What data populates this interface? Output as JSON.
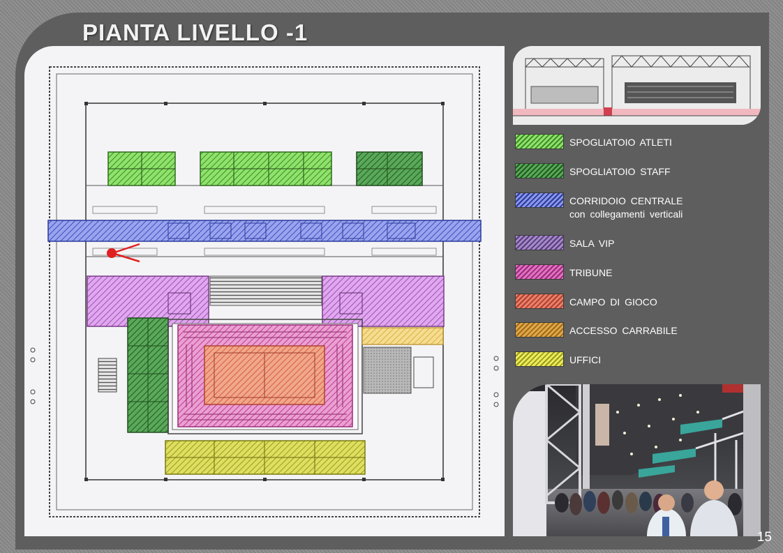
{
  "page": {
    "title": "PIANTA LIVELLO -1",
    "page_number": "15"
  },
  "legend": [
    {
      "label": "SPOGLIATOIO ATLETI",
      "sub": "",
      "color": "#7ed957"
    },
    {
      "label": "SPOGLIATOIO STAFF",
      "sub": "",
      "color": "#3c8a3c"
    },
    {
      "label": "CORRIDOIO CENTRALE",
      "sub": "con collegamenti verticali",
      "color": "#3b4fbf"
    },
    {
      "label": "SALA VIP",
      "sub": "",
      "color": "#7a5aa0"
    },
    {
      "label": "TRIBUNE",
      "sub": "",
      "color": "#c0389a"
    },
    {
      "label": "CAMPO DI GIOCO",
      "sub": "",
      "color": "#d65a4e"
    },
    {
      "label": "ACCESSO CARRABILE",
      "sub": "",
      "color": "#d08a2e"
    },
    {
      "label": "UFFICI",
      "sub": "",
      "color": "#d8d83a"
    }
  ],
  "colors": {
    "athletes": "#7ed957",
    "staff": "#3c8a3c",
    "corridor": "#3b4fbf",
    "vip": "#7a5aa0",
    "tribune": "#c0389a",
    "field": "#d65a4e",
    "driveway": "#d08a2e",
    "offices": "#d8d83a",
    "marker": "#e02020"
  },
  "icons": {
    "location_marker": "location-marker-icon"
  }
}
